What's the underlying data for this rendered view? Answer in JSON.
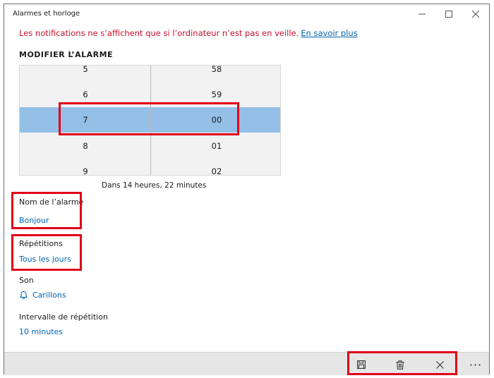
{
  "window": {
    "title": "Alarmes et horloge"
  },
  "notice": {
    "text": "Les notifications ne s’affichent que si l’ordinateur n’est pas en veille.",
    "link": "En savoir plus"
  },
  "section_title": "MODIFIER L’ALARME",
  "picker": {
    "hours": [
      "5",
      "6",
      "7",
      "8",
      "9"
    ],
    "minutes": [
      "58",
      "59",
      "00",
      "01",
      "02"
    ],
    "selected_hour": "7",
    "selected_minute": "00"
  },
  "countdown": "Dans 14 heures, 22 minutes",
  "fields": {
    "name": {
      "label": "Nom de l’alarme",
      "value": "Bonjour"
    },
    "repeat": {
      "label": "Répétitions",
      "value": "Tous les jours"
    },
    "sound": {
      "label": "Son",
      "value": "Carillons",
      "icon": "bell-icon"
    },
    "snooze": {
      "label": "Intervalle de répétition",
      "value": "10 minutes"
    }
  },
  "commands": {
    "icons": [
      "save-icon",
      "trash-icon",
      "close-icon",
      "more-icon"
    ],
    "more_glyph": "···"
  },
  "colors": {
    "accent": "#0063b1",
    "warning": "#c8102e",
    "selection": "#94bfe7",
    "highlight": "#e0001a"
  }
}
